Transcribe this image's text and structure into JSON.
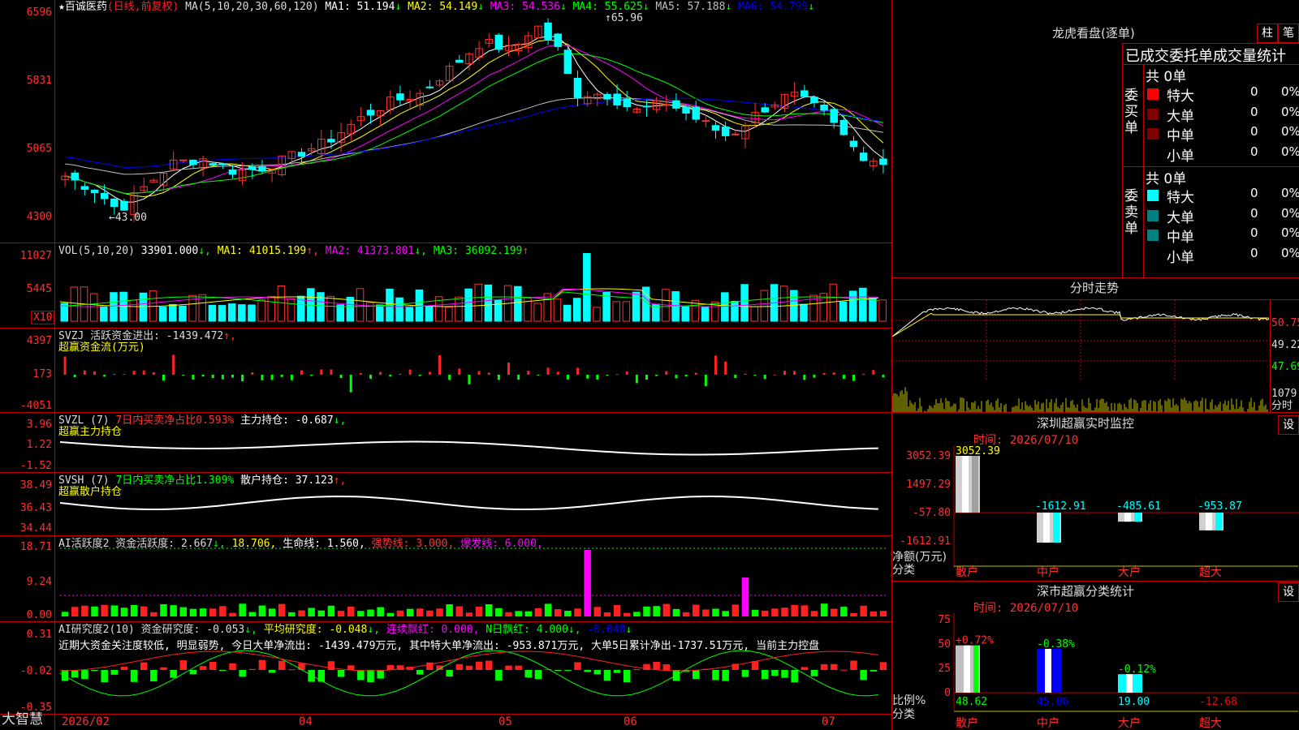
{
  "stock": {
    "name": "百诚医药",
    "mode": "(日线,前复权)",
    "star": "★",
    "ma_prefix": "MA(5,10,20,30,60,120)",
    "ma": [
      {
        "label": "MA1:",
        "value": "51.194",
        "arrow": "↓",
        "color": "#ffffff"
      },
      {
        "label": "MA2:",
        "value": "54.149",
        "arrow": "↓",
        "color": "#ffff00"
      },
      {
        "label": "MA3:",
        "value": "54.536",
        "arrow": "↓",
        "color": "#ff00ff"
      },
      {
        "label": "MA4:",
        "value": "55.625",
        "arrow": "↓",
        "color": "#00ff00"
      },
      {
        "label": "MA5:",
        "value": "57.188",
        "arrow": "↓",
        "color": "#c0c0c0"
      },
      {
        "label": "MA6:",
        "value": "54.799",
        "arrow": "↓",
        "color": "#0000ff"
      }
    ]
  },
  "price_axis": [
    "6596",
    "5831",
    "5065",
    "4300"
  ],
  "price_annotations": {
    "high": "65.96",
    "low": "43.00",
    "high_arrow": "↑",
    "low_arrow": "←"
  },
  "vol": {
    "prefix": "VOL(5,10,20)",
    "value": "33901.000",
    "value_arrow": "↓,",
    "ma1": "MA1: 41015.199",
    "ma1_arrow": "↑,",
    "ma2": "MA2: 41373.801",
    "ma2_arrow": "↓,",
    "ma3": "MA3: 36092.199",
    "ma3_arrow": "↑",
    "axis": [
      "11027",
      "5445"
    ],
    "x10": "X10"
  },
  "svzj": {
    "line1": "SVZJ  活跃资金进出: -1439.472",
    "line1_arrow": "↑,",
    "line2": "超赢资金流(万元)",
    "axis": [
      "4397",
      "173",
      "-4051"
    ]
  },
  "svzl": {
    "prefix": "SVZL (7)",
    "ratio": "7日内买卖净占比0.593%",
    "holding": " 主力持仓: -0.687",
    "holding_arrow": "↓,",
    "line2": "超赢主力持仓",
    "axis": [
      "3.96",
      "1.22",
      "-1.52"
    ]
  },
  "svsh": {
    "prefix": "SVSH (7)",
    "ratio": "7日内买卖净占比1.309%",
    "holding": " 散户持仓: 37.123",
    "holding_arrow": "↑,",
    "line2": "超赢散户持仓",
    "axis": [
      "38.49",
      "36.43",
      "34.44"
    ]
  },
  "ai_active": {
    "prefix": "AI活跃度2 资金活跃度: 2.667",
    "a1": "↓,",
    "v2": "18.706,",
    "life": " 生命线: 1.560,",
    "strong": " 强势线: 3.000,",
    "burst": " 爆发线: 6.000,",
    "axis": [
      "18.71",
      "9.24",
      "0.00"
    ]
  },
  "ai_research": {
    "prefix": "AI研究度2(10) 资金研究度: -0.053",
    "a1": "↓,",
    "avg": " 平均研究度: -0.048",
    "a2": "↓,",
    "red": " 连续飘红: 0.000,",
    "nred": " N日飘红: 4.000",
    "a3": "↓,",
    "v": " -0.048",
    "a4": "↓",
    "comment": "近期大资金关注度较低, 明显弱势, 今日大单净流出: -1439.479万元, 其中特大单净流出: -953.871万元, 大单5日累计净出-1737.51万元, 当前主力控盘",
    "axis": [
      "0.31",
      "-0.02",
      "-0.35"
    ]
  },
  "x_axis": [
    "2026/02",
    "04",
    "05",
    "06",
    "07"
  ],
  "footer_brand": "大智慧",
  "longhu": {
    "title": "龙虎看盘(逐单)",
    "btn_zhu": "柱",
    "btn_bi": "笔",
    "header": "已成交委托单成交量统计",
    "buy_side": [
      "委",
      "买",
      "单"
    ],
    "sell_side": [
      "委",
      "卖",
      "单"
    ],
    "buy_total": "共 0单",
    "sell_total": "共 0单",
    "buy_rows": [
      {
        "label": "特大",
        "count": "0",
        "pct": "0%",
        "color": "#ff0000"
      },
      {
        "label": "大单",
        "count": "0",
        "pct": "0%",
        "color": "#800000"
      },
      {
        "label": "中单",
        "count": "0",
        "pct": "0%",
        "color": "#800000"
      },
      {
        "label": "小单",
        "count": "0",
        "pct": "0%",
        "color": ""
      }
    ],
    "sell_rows": [
      {
        "label": "特大",
        "count": "0",
        "pct": "0%",
        "color": "#00ffff"
      },
      {
        "label": "大单",
        "count": "0",
        "pct": "0%",
        "color": "#008080"
      },
      {
        "label": "中单",
        "count": "0",
        "pct": "0%",
        "color": "#008080"
      },
      {
        "label": "小单",
        "count": "0",
        "pct": "0%",
        "color": ""
      }
    ]
  },
  "intraday": {
    "title": "分时走势",
    "axis": [
      "50.75",
      "49.22",
      "47.69"
    ],
    "vol_axis": [
      "1079",
      "分时"
    ]
  },
  "sz_monitor": {
    "title": "深圳超赢实时监控",
    "btn": "设",
    "time": "时间: 2026/07/10",
    "axis": [
      "3052.39",
      "1497.29",
      "-57.80",
      "-1612.91"
    ],
    "unit_label": "净额(万元)",
    "cat_label": "分类",
    "bars": [
      {
        "cat": "散户",
        "value": 3052.39,
        "label": "3052.39"
      },
      {
        "cat": "中户",
        "value": -1612.91,
        "label": "-1612.91"
      },
      {
        "cat": "大户",
        "value": -485.61,
        "label": "-485.61"
      },
      {
        "cat": "超大",
        "value": -953.87,
        "label": "-953.87"
      }
    ]
  },
  "sz_class": {
    "title": "深市超赢分类统计",
    "btn": "设",
    "time": "时间: 2026/07/10",
    "axis": [
      "75",
      "50",
      "25",
      "0"
    ],
    "unit_label": "比例%",
    "cat_label": "分类",
    "bars": [
      {
        "cat": "散户",
        "value": 48.62,
        "label": "48.62",
        "delta": "+0.72%"
      },
      {
        "cat": "中户",
        "value": 45.06,
        "label": "45.06",
        "delta": "-0.38%"
      },
      {
        "cat": "大户",
        "value": 19.0,
        "label": "19.00",
        "delta": "-0.12%"
      },
      {
        "cat": "超大",
        "value": -12.68,
        "label": "-12.68",
        "delta": ""
      }
    ]
  }
}
